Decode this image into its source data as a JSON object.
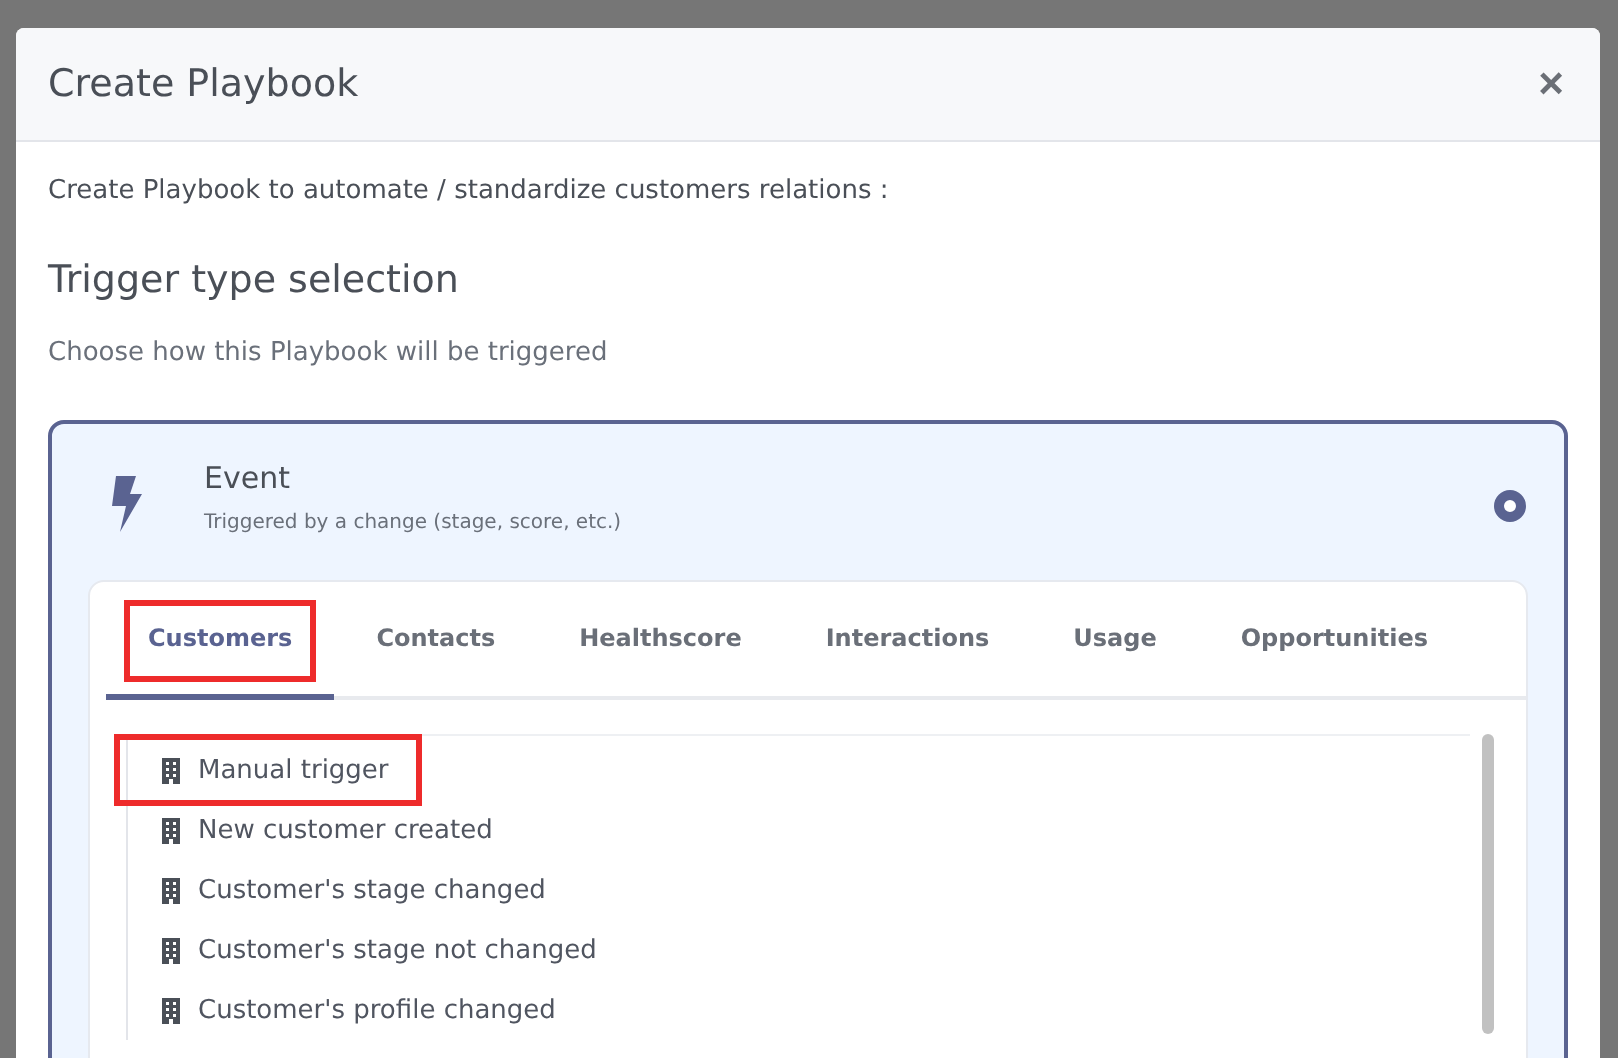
{
  "dialog": {
    "title": "Create Playbook",
    "close": "×"
  },
  "intro": "Create Playbook to automate / standardize customers relations :",
  "section": {
    "title": "Trigger type selection",
    "subtitle": "Choose how this Playbook will be triggered"
  },
  "trigger_option": {
    "title": "Event",
    "description": "Triggered by a change (stage, score, etc.)",
    "selected": true
  },
  "tabs": [
    {
      "label": "Customers",
      "selected": true,
      "highlighted": true
    },
    {
      "label": "Contacts",
      "selected": false,
      "highlighted": false
    },
    {
      "label": "Healthscore",
      "selected": false,
      "highlighted": false
    },
    {
      "label": "Interactions",
      "selected": false,
      "highlighted": false
    },
    {
      "label": "Usage",
      "selected": false,
      "highlighted": false
    },
    {
      "label": "Opportunities",
      "selected": false,
      "highlighted": false
    }
  ],
  "events": [
    {
      "label": "Manual trigger",
      "highlighted": true
    },
    {
      "label": "New customer created",
      "highlighted": false
    },
    {
      "label": "Customer's stage changed",
      "highlighted": false
    },
    {
      "label": "Customer's stage not changed",
      "highlighted": false
    },
    {
      "label": "Customer's profile changed",
      "highlighted": false
    }
  ]
}
